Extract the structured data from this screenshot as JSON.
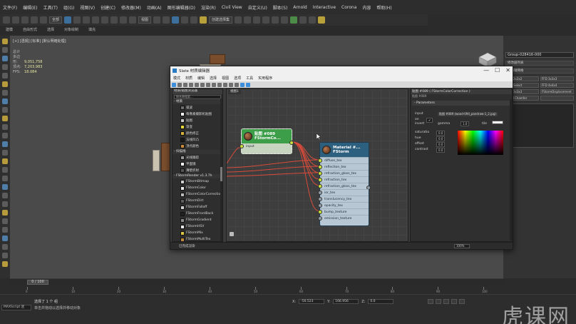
{
  "menus": [
    "文件(F)",
    "编辑(E)",
    "工具(T)",
    "组(G)",
    "视图(V)",
    "创建(C)",
    "修改器(M)",
    "动画(A)",
    "图形编辑器(D)",
    "渲染(R)",
    "Civil View",
    "自定义(U)",
    "脚本(S)",
    "Arnold",
    "Interactive",
    "Corona",
    "内容",
    "帮助(H)"
  ],
  "toolbar": {
    "filter_label": "全部",
    "view_label": "视图",
    "selection_set_label": "创建选择集"
  },
  "ribbon": [
    "建模",
    "自由形式",
    "选择",
    "对象绘制",
    "填充"
  ],
  "viewport": {
    "label": "[+] [透视] [标准] [默认明暗处理]",
    "stats": [
      {
        "label": "总计",
        "value": ""
      },
      {
        "label": "多边形:",
        "value": "9,051,758"
      },
      {
        "label": "顶点:",
        "value": "7,203,983"
      },
      {
        "label": "FPS:",
        "value": "18.084"
      }
    ]
  },
  "command_panel": {
    "name_field": "Group-028416-000",
    "roll_1": "修改器列表",
    "roll_2": "可编辑网格",
    "buttons": [
      "FFD 2x2x2",
      "FFD 3x3x3",
      "FFD Select",
      "FFD 4x4x4",
      "FFD 3x3x3",
      "FStormDisplacement",
      "Shell Chamfer",
      ""
    ]
  },
  "timeline": {
    "slider": "0 / 100",
    "ticks": [
      "0",
      "10",
      "20",
      "30",
      "40",
      "50",
      "60",
      "70",
      "80",
      "90",
      "100"
    ]
  },
  "status": {
    "maxscript": "MAXScript 迷",
    "selection": "选择了 1 个 组",
    "prompt": "单击并拖动以选择并移动对象",
    "x_label": "X:",
    "x_value": "-56.523",
    "y_label": "Y:",
    "y_value": "166.956",
    "z_label": "Z:",
    "z_value": "0.0",
    "watermark": "虎课网"
  },
  "slate": {
    "title": "Slate 材质编辑器",
    "menus": [
      "模式",
      "材质",
      "编辑",
      "选择",
      "视图",
      "选项",
      "工具",
      "实用程序"
    ],
    "browser_title": "材质/贴图浏览器",
    "browser_search": "按名称搜索...",
    "groups": [
      {
        "label": "- 材质",
        "items": []
      },
      {
        "label": "",
        "items": [
          {
            "name": "噪波",
            "color": "#6f6f6f"
          },
          {
            "name": "每像素摄影机贴图",
            "color": "#ffffff"
          },
          {
            "name": "贴图",
            "color": "#c8c8c8"
          },
          {
            "name": "渐变",
            "color": "#e6d73a"
          },
          {
            "name": "颜色修正",
            "color": "#d4b03c"
          },
          {
            "name": "法线凹凸",
            "color": "#1a1a1a"
          },
          {
            "name": "顶点颜色",
            "color": "#c98a3a"
          }
        ]
      },
      {
        "label": "- 扫描线",
        "items": [
          {
            "name": "光线跟踪",
            "color": "#999999"
          },
          {
            "name": "平面镜",
            "color": "#ffffff"
          },
          {
            "name": "薄壁折射",
            "color": "#555555"
          }
        ]
      },
      {
        "label": "- FStormRender v1.3.7h",
        "items": [
          {
            "name": "FStormBitmap",
            "color": "#cfcfcf"
          },
          {
            "name": "FStormColor",
            "color": "#e8e8e8"
          },
          {
            "name": "FStormColorCorrection",
            "color": "#bdbdbd"
          },
          {
            "name": "FStormDirt",
            "color": "#5e5e5e"
          },
          {
            "name": "FStormFalloff",
            "color": "#d0d0d0"
          },
          {
            "name": "FStormFrontBack",
            "color": "#222222"
          },
          {
            "name": "FStormGradient",
            "color": "#8a8a8a"
          },
          {
            "name": "FStormHSV",
            "color": "#e9e9e9"
          },
          {
            "name": "FStormMix",
            "color": "#d9c642"
          },
          {
            "name": "FStormMultiTex",
            "color": "#c08a3e"
          }
        ]
      }
    ],
    "view_tab": "视图1",
    "node_cc": {
      "title_1": "贴图 #089",
      "title_2": "FStormCo...",
      "port_label": "input"
    },
    "node_mat": {
      "title_1": "Material #...",
      "title_2": "FStorm",
      "slots": [
        "diffuse_tex",
        "reflection_tex",
        "refraction_gloss_tex",
        "refraction_tex",
        "refraction_gloss_tex",
        "ior_tex",
        "translucency_tex",
        "opacity_tex",
        "bump_texture",
        "emission_texture"
      ],
      "connected": [
        true,
        true,
        true,
        true,
        true,
        false,
        false,
        false,
        true,
        false
      ]
    },
    "params": {
      "header": "贴图 #089 ( FStormColorCorrection )",
      "sub": "贴图 #089",
      "rollout": "- Parameters",
      "input_label": "input",
      "input_value": "贴图 #089 (wood-094_pandraw-1_2.jpg)",
      "rows": [
        {
          "label": "on",
          "value": "✔"
        },
        {
          "label": "invert",
          "value": ""
        },
        {
          "label": "gamma",
          "value": "1.0"
        },
        {
          "label": "tile",
          "value": ""
        },
        {
          "label": "saturatio",
          "value": "0.0"
        },
        {
          "label": "hue",
          "value": "0.0"
        },
        {
          "label": "offset",
          "value": "0.0"
        },
        {
          "label": "contrast",
          "value": "0.0"
        }
      ]
    },
    "status_text": "已完成渲染",
    "zoom": "100%"
  }
}
